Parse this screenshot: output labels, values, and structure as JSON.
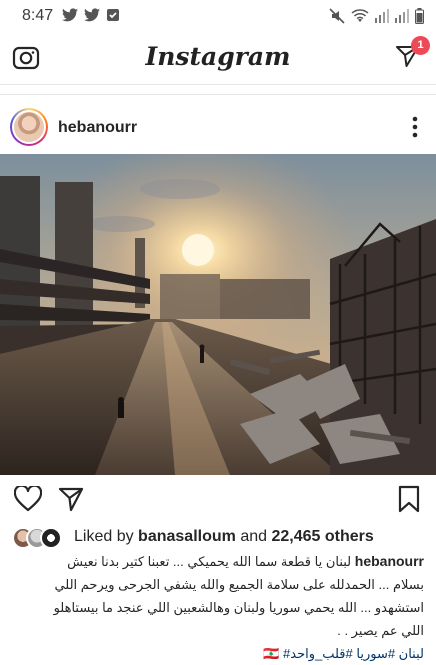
{
  "status_bar": {
    "time": "8:47"
  },
  "app": {
    "title": "Instagram",
    "dm_badge": "1"
  },
  "post": {
    "username": "hebanourr",
    "photo_alt": "Sunset over a damaged street with debris and partially destroyed buildings",
    "likes": {
      "prefix": "Liked by",
      "user": "banasalloum",
      "middle": "and",
      "count": "22,465 others"
    },
    "caption": {
      "user": "hebanourr",
      "line1": "لبنان يا قطعة سما الله يحميكي ... تعبنا كتير بدنا نعيش",
      "line2": "بسلام ... الحمدلله على سلامة الجميع والله يشفي الجرحى ويرحم اللي",
      "line3": "استشهدو ... الله يحمي سوريا ولبنان وهالشعبين اللي عنجد ما بيستاهلو",
      "line4": "اللي عم يصير . .",
      "tags": "لبنان #سوريا #قلب_واحد#",
      "flag": "🇱🇧"
    }
  },
  "colors": {
    "badge": "#ed4956",
    "hashtag": "#003569"
  }
}
